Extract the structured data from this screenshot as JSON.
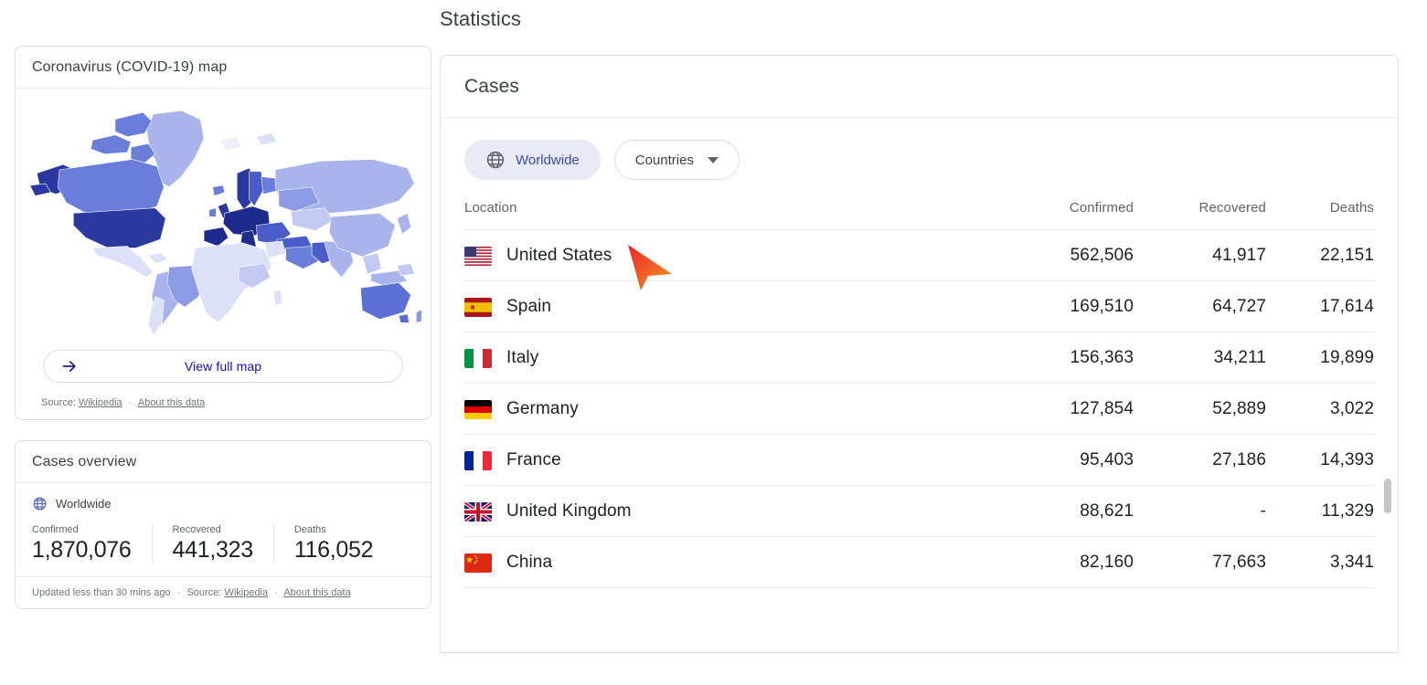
{
  "page_title": "Statistics",
  "map_card": {
    "title": "Coronavirus (COVID-19) map",
    "view_full_map_label": "View full map",
    "arrow_icon": "arrow-right-icon",
    "source_prefix": "Source:",
    "source_link": "Wikipedia",
    "about_link": "About this data",
    "separator": "·"
  },
  "overview_card": {
    "title": "Cases overview",
    "scope_icon": "globe-icon",
    "scope_label": "Worldwide",
    "stats": [
      {
        "label": "Confirmed",
        "value": "1,870,076"
      },
      {
        "label": "Recovered",
        "value": "441,323"
      },
      {
        "label": "Deaths",
        "value": "116,052"
      }
    ],
    "updated_text": "Updated less than 30 mins ago",
    "source_prefix": "Source:",
    "source_link": "Wikipedia",
    "about_link": "About this data",
    "separator": "·"
  },
  "cases_panel": {
    "title": "Cases",
    "filters": [
      {
        "label": "Worldwide",
        "icon": "globe-icon",
        "active": true
      },
      {
        "label": "Countries",
        "icon": "chevron-down-icon",
        "active": false
      }
    ],
    "columns": [
      "Location",
      "Confirmed",
      "Recovered",
      "Deaths"
    ],
    "rows": [
      {
        "flag": "us-flag-icon",
        "location": "United States",
        "confirmed": "562,506",
        "recovered": "41,917",
        "deaths": "22,151"
      },
      {
        "flag": "es-flag-icon",
        "location": "Spain",
        "confirmed": "169,510",
        "recovered": "64,727",
        "deaths": "17,614"
      },
      {
        "flag": "it-flag-icon",
        "location": "Italy",
        "confirmed": "156,363",
        "recovered": "34,211",
        "deaths": "19,899"
      },
      {
        "flag": "de-flag-icon",
        "location": "Germany",
        "confirmed": "127,854",
        "recovered": "52,889",
        "deaths": "3,022"
      },
      {
        "flag": "fr-flag-icon",
        "location": "France",
        "confirmed": "95,403",
        "recovered": "27,186",
        "deaths": "14,393"
      },
      {
        "flag": "gb-flag-icon",
        "location": "United Kingdom",
        "confirmed": "88,621",
        "recovered": "-",
        "deaths": "11,329"
      },
      {
        "flag": "cn-flag-icon",
        "location": "China",
        "confirmed": "82,160",
        "recovered": "77,663",
        "deaths": "3,341"
      }
    ]
  },
  "colors": {
    "accent_blue": "#1a0dab",
    "pill_active_bg": "#e8eaf6",
    "pill_active_text": "#3949ab",
    "cursor_start": "#e8252a",
    "cursor_end": "#f79521",
    "map_dark": "#2a38a0",
    "map_mid": "#5c6fd4",
    "map_light": "#aab4ec",
    "map_lightest": "#dde1f7"
  },
  "chart_data": {
    "type": "table",
    "title": "Cases",
    "categories": [
      "United States",
      "Spain",
      "Italy",
      "Germany",
      "France",
      "United Kingdom",
      "China"
    ],
    "series": [
      {
        "name": "Confirmed",
        "values": [
          562506,
          169510,
          156363,
          127854,
          95403,
          88621,
          82160
        ]
      },
      {
        "name": "Recovered",
        "values": [
          41917,
          64727,
          34211,
          52889,
          27186,
          null,
          77663
        ]
      },
      {
        "name": "Deaths",
        "values": [
          22151,
          17614,
          19899,
          3022,
          14393,
          11329,
          3341
        ]
      }
    ],
    "totals": {
      "Confirmed": 1870076,
      "Recovered": 441323,
      "Deaths": 116052
    }
  }
}
